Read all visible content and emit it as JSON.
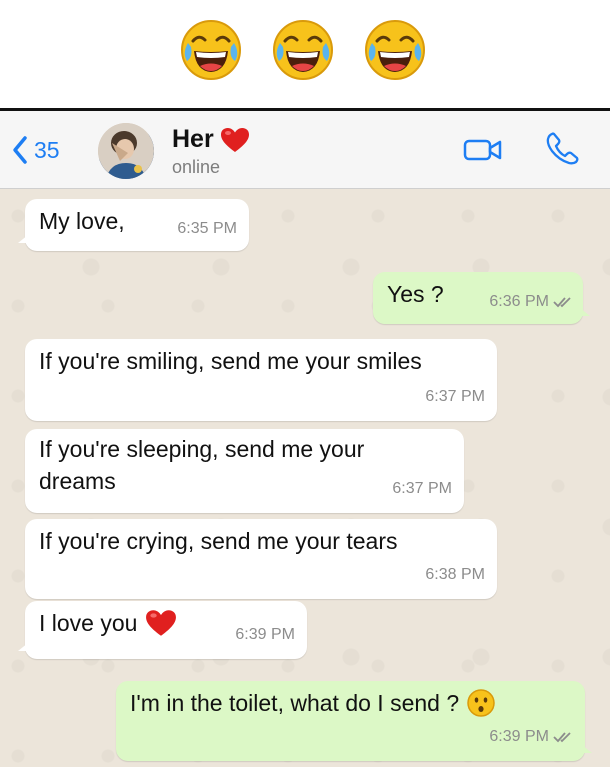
{
  "header_emojis": [
    "face-with-tears-of-joy",
    "face-with-tears-of-joy",
    "face-with-tears-of-joy"
  ],
  "chat_header": {
    "back_count": "35",
    "contact_name": "Her",
    "status": "online",
    "name_emoji": "red-heart"
  },
  "messages": [
    {
      "direction": "in",
      "text": "My love,",
      "time": "6:35 PM"
    },
    {
      "direction": "out",
      "text": "Yes ?",
      "time": "6:36 PM",
      "status": "read"
    },
    {
      "direction": "in",
      "text": "If you're smiling, send me your smiles",
      "time": "6:37 PM"
    },
    {
      "direction": "in",
      "text_line1": "If you're sleeping, send me your",
      "text_line2": "dreams",
      "time": "6:37 PM"
    },
    {
      "direction": "in",
      "text": "If you're crying, send me your tears",
      "time": "6:38 PM"
    },
    {
      "direction": "in",
      "text": "I love you",
      "emoji": "red-heart",
      "time": "6:39 PM"
    },
    {
      "direction": "out",
      "text": "I'm in the toilet, what do I send ?",
      "emoji": "hushed-face",
      "time": "6:39 PM",
      "status": "read"
    }
  ],
  "colors": {
    "accent": "#1e7ef3",
    "chat_background": "#ece5da",
    "incoming_bubble": "#ffffff",
    "outgoing_bubble": "#dcf8c6",
    "read_ticks": "#8c8c8c"
  }
}
